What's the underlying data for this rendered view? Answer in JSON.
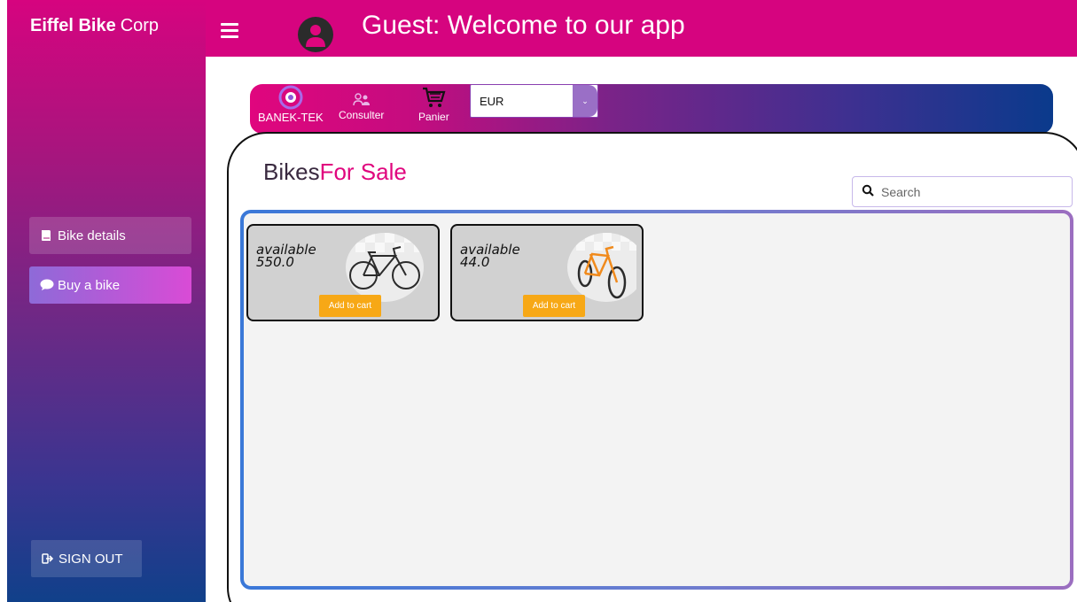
{
  "brand": {
    "bold": "Eiffel Bike",
    "light": "Corp"
  },
  "sidebar": {
    "items": [
      {
        "label": "Bike details",
        "icon": "book-icon"
      },
      {
        "label": "Buy a bike",
        "icon": "speech-bubble-icon"
      }
    ],
    "signout_label": "SIGN OUT",
    "signout_icon": "sign-out-icon"
  },
  "topbar": {
    "welcome": "Guest: Welcome to our app",
    "avatar_icon": "user-icon",
    "menu_icon": "hamburger-icon"
  },
  "nav": {
    "brand_label": "BANEK-TEK",
    "consult_label": "Consulter",
    "cart_label": "Panier",
    "currency_selected": "EUR"
  },
  "main": {
    "title_part1": "Bikes",
    "title_part2": "For Sale",
    "search_placeholder": "Search"
  },
  "products": [
    {
      "status": "available",
      "price": "550.0",
      "button": "Add to cart",
      "bike_color": "#2b2b2b"
    },
    {
      "status": "available",
      "price": "44.0",
      "button": "Add to cart",
      "bike_color": "#f08a1c"
    }
  ],
  "colors": {
    "accent_pink": "#d6047f",
    "button_orange": "#f7a816",
    "sidebar_bottom": "#10408a"
  }
}
